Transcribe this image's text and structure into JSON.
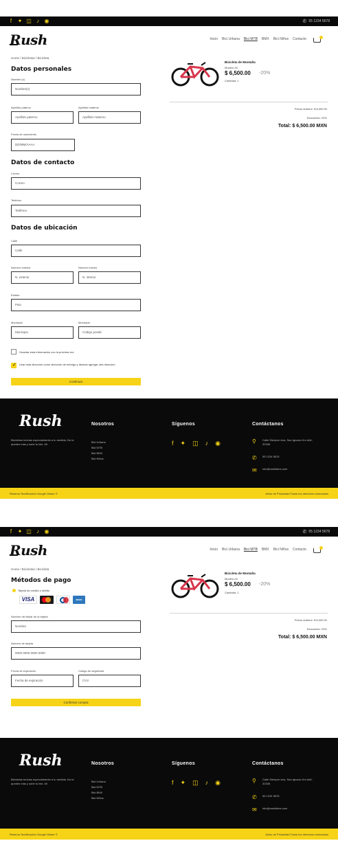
{
  "social_icons": [
    "facebook-icon",
    "twitter-icon",
    "instagram-icon",
    "tiktok-icon",
    "pinterest-icon"
  ],
  "topbar": {
    "phone": "55 1234 5678"
  },
  "brand": {
    "logo": "Rush"
  },
  "nav": {
    "items": [
      "Inicio",
      "Bici Urbana",
      "Bici MTB",
      "BMX",
      "Bici Niños",
      "Contacto"
    ]
  },
  "breadcrumb": "Home / Bicicletas / Bicicleta",
  "checkout": {
    "personal_title": "Datos personales",
    "fields": {
      "name_label": "Nombre (s)",
      "name_value": "Nombre(s)",
      "last1_label": "Apellido paterno",
      "last1_value": "Apellido paterno",
      "last2_label": "Apellido materno",
      "last2_value": "Apellido materno",
      "birth_label": "Fecha de nacimiento",
      "birth_value": "DD/MM/AAAA"
    },
    "contact_title": "Datos de contacto",
    "contact": {
      "email_label": "Correo",
      "email_value": "Correo",
      "phone_label": "Teléfono",
      "phone_value": "Teléfono"
    },
    "location_title": "Datos de ubicación",
    "location": {
      "street_label": "Calle",
      "street_value": "Calle",
      "ext_label": "Número exterior",
      "ext_value": "N. exterior",
      "int_label": "Número interior",
      "int_value": "N. interior",
      "state_label": "Estado",
      "state_value": "Pais",
      "city_label": "Municipio",
      "city_value": "Municipio",
      "zip_label": "Municipio",
      "zip_value": "Código postal"
    },
    "save_info": "Guardar esta información con la próxima vez",
    "note_info": "Usar esta dirección como dirección de entrega y deseas agregar otra dirección",
    "continue_button": "Continuar"
  },
  "payment": {
    "title": "Métodos de pago",
    "option": "Tarjeta de crédito o débito",
    "cards": [
      "VISA",
      "mastercard",
      "diners",
      "amex"
    ],
    "holder_label": "Nombre del titular de la tarjeta",
    "holder_value": "Nombre",
    "number_label": "Número de tarjeta",
    "number_value": "0000 0000 0000 0000",
    "exp_label": "Fecha de expiración",
    "exp_value": "Fecha de expiración",
    "cvv_label": "Código de seguridad",
    "cvv_value": "CVV",
    "confirm_button": "Confirmar compra"
  },
  "summary": {
    "product_name": "Bicicleta de Montaña",
    "product_brand": "Modelo 26",
    "price": "$ 6,500.00",
    "discount_badge": "-20%",
    "quantity": "Cantidad: 1",
    "previous_price": "Precio anterior: $ 8,000.00",
    "discount_line": "Descuento: 20%",
    "total": "Total: $ 6,500.00 MXN"
  },
  "footer": {
    "logo": "Rush",
    "description": "Bicicletas hechas especialmente a tu medida. No te quedes más y sube tu bici. ##",
    "nosotros_title": "Nosotros",
    "nosotros_items": [
      "Bici Urbana",
      "Bici MTB",
      "Bici BMX",
      "Bici Niños"
    ],
    "siguenos_title": "Síguenos",
    "contact_title": "Contáctanos",
    "address": "Calle Siempre viva, San Ignacio Km ###, 32345",
    "phone": "55 1234 5678",
    "email": "info@rushbikes.com"
  },
  "footbar": {
    "left": "Reserva Tecnificación Google Geiser ©",
    "right": "Aviso de Privacidad  Todos los derechos reservados"
  },
  "colors": {
    "accent": "#f6d316",
    "dark": "#0a0a0a",
    "bike": "#d8354b"
  }
}
